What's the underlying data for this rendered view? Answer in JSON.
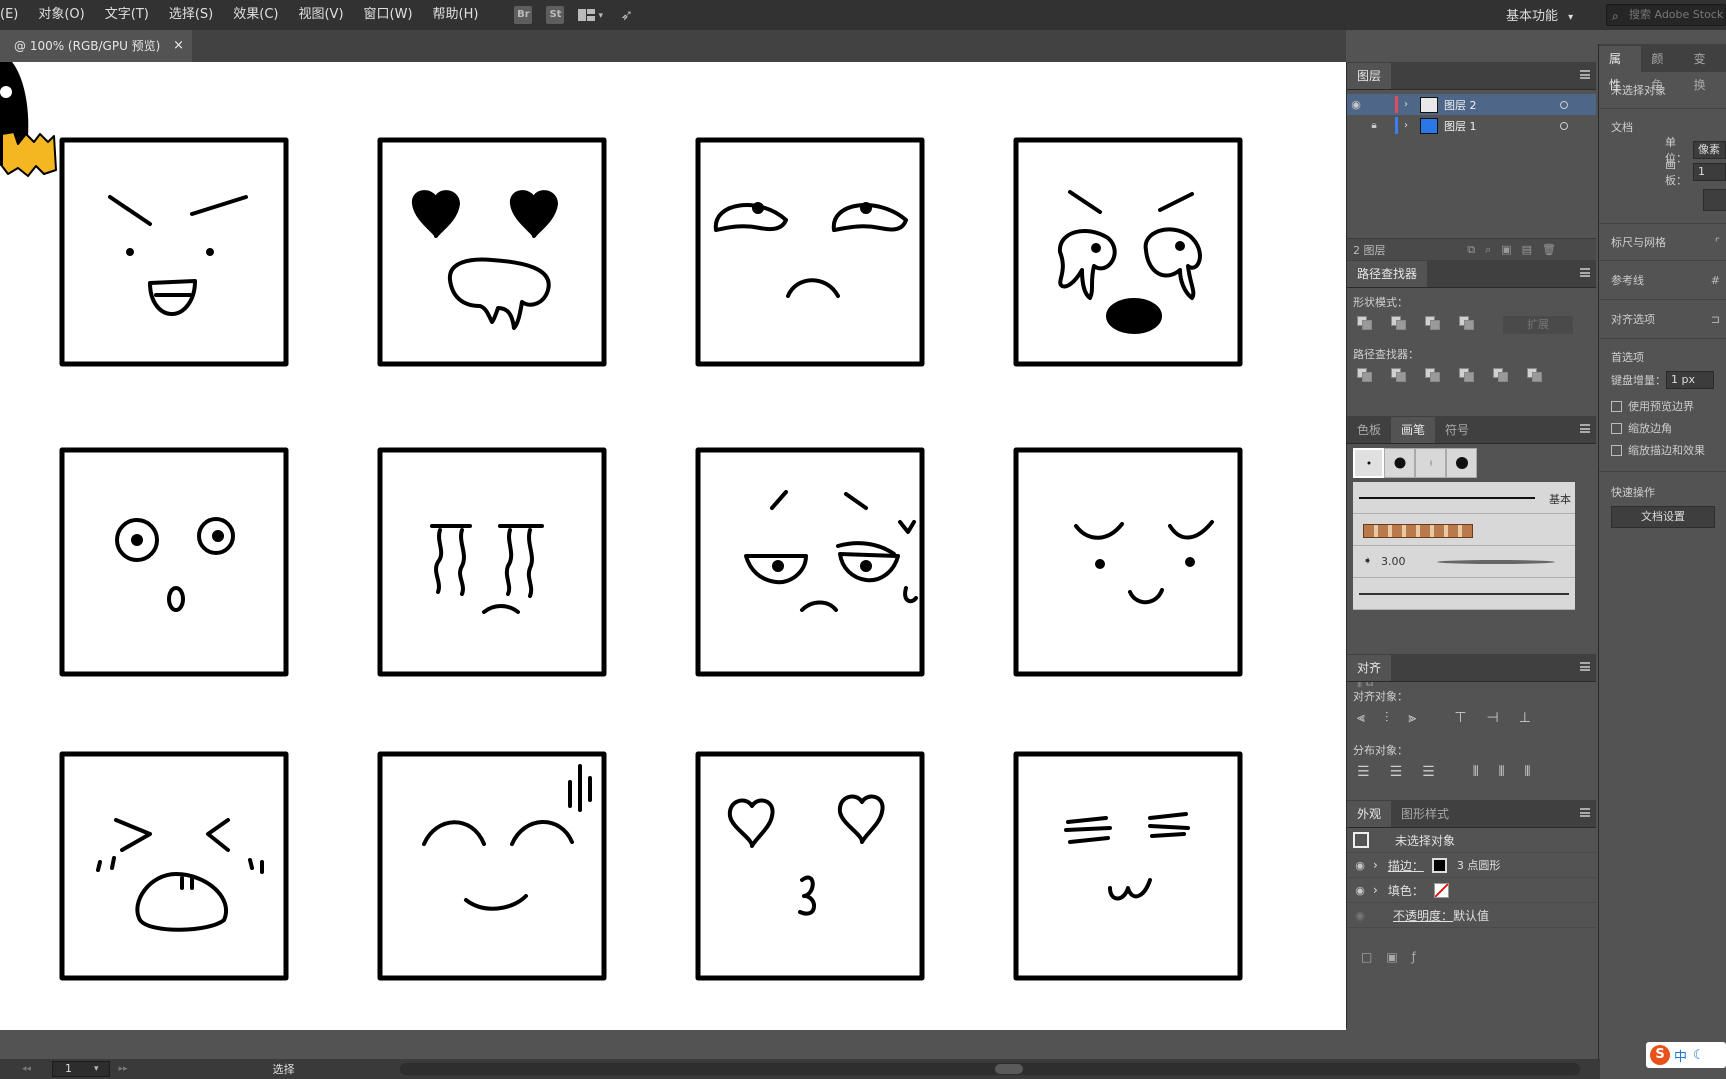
{
  "menu": [
    "(E)",
    "对象(O)",
    "文字(T)",
    "选择(S)",
    "效果(C)",
    "视图(V)",
    "窗口(W)",
    "帮助(H)"
  ],
  "toolbar_icons": [
    "Br",
    "St"
  ],
  "workspace": "基本功能",
  "search_placeholder": "搜索 Adobe Stock",
  "document_tab": {
    "label": "@ 100% (RGB/GPU 预览)",
    "close": "×"
  },
  "layers_panel": {
    "title": "图层",
    "layers": [
      {
        "name": "图层 2",
        "color": "#e24b5b",
        "selected": true
      },
      {
        "name": "图层 1",
        "color": "#3b7ff0",
        "selected": false
      }
    ],
    "count": "2 图层"
  },
  "pathfinder": {
    "title": "路径查找器",
    "shape_modes_label": "形状模式：",
    "expand_label": "扩展",
    "pathfinders_label": "路径查找器："
  },
  "brushes_panel": {
    "tabs": [
      "色板",
      "画笔",
      "符号"
    ],
    "active_tab": "画笔",
    "basic_label": "基本",
    "brush_size": "3.00"
  },
  "align_panel": {
    "title": "对齐",
    "align_objects_label": "对齐对象：",
    "distribute_objects_label": "分布对象："
  },
  "appearance_panel": {
    "tabs": [
      "外观",
      "图形样式"
    ],
    "no_selection": "未选择对象",
    "stroke_label": "描边：",
    "stroke_value": "3 点圆形",
    "fill_label": "填色：",
    "opacity_label": "不透明度：",
    "opacity_value": "默认值"
  },
  "properties_panel": {
    "tabs": [
      "属性",
      "颜色",
      "变换"
    ],
    "no_selection": "未选择对象",
    "document_label": "文档",
    "units_label": "单位：",
    "units_value": "像素",
    "artboard_label": "画板：",
    "artboard_value": "1",
    "rulers_label": "标尺与网格",
    "guides_label": "参考线",
    "snap_label": "对齐选项",
    "prefs_label": "首选项",
    "keyboard_increment_label": "键盘增量：",
    "keyboard_increment_value": "1 px",
    "checkboxes": [
      "使用预览边界",
      "缩放边角",
      "缩放描边和效果"
    ],
    "quick_actions_label": "快速操作",
    "doc_settings_button": "文档设置"
  },
  "status": {
    "page": "1",
    "mode": "选择"
  },
  "ime": {
    "logo": "S",
    "lang": "中"
  }
}
